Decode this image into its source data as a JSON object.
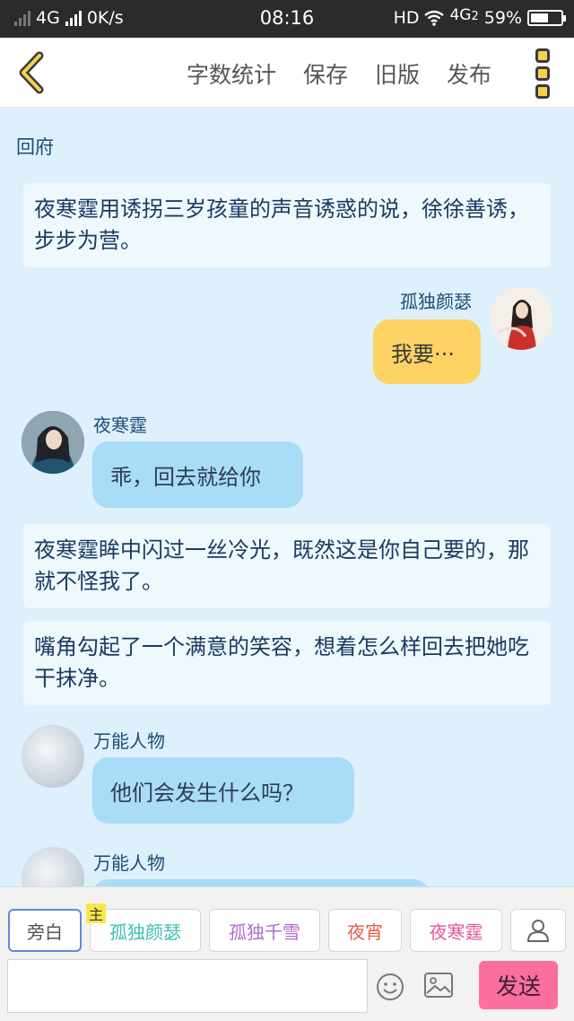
{
  "status_bar": {
    "network": "4G",
    "speed": "0K/s",
    "time": "08:16",
    "hd": "HD",
    "network_right": "4G",
    "network_right_sub": "2",
    "battery": "59%",
    "battery_level": 0.59
  },
  "header": {
    "back_icon": "chevron-left-icon",
    "nav": [
      "字数统计",
      "保存",
      "旧版",
      "发布"
    ],
    "more_icon": "more-vertical-icon"
  },
  "chat": {
    "chapter": "回府",
    "narration_1": "夜寒霆用诱拐三岁孩童的声音诱惑的说，徐徐善诱，步步为营。",
    "msg_1": {
      "name": "孤独颜瑟",
      "text": "我要···"
    },
    "msg_2": {
      "name": "夜寒霆",
      "text": "乖，回去就给你"
    },
    "narration_2": "夜寒霆眸中闪过一丝冷光，既然这是你自己要的，那就不怪我了。",
    "narration_3": "嘴角勾起了一个满意的笑容，想着怎么样回去把她吃干抹净。",
    "msg_3": {
      "name": "万能人物",
      "text": "他们会发生什么吗？"
    },
    "msg_4": {
      "name": "万能人物",
      "text": ""
    }
  },
  "bottom": {
    "roles": [
      {
        "label": "旁白",
        "color": "#555555"
      },
      {
        "label": "孤独颜瑟",
        "color": "#3dbfb0"
      },
      {
        "label": "孤独千雪",
        "color": "#b36ad1"
      },
      {
        "label": "夜宵",
        "color": "#e06048"
      },
      {
        "label": "夜寒霆",
        "color": "#e2579a"
      }
    ],
    "host_tag": "主",
    "add_role_icon": "person-icon",
    "input_value": "",
    "input_placeholder": "",
    "emoji_icon": "smiley-icon",
    "image_icon": "image-icon",
    "send_label": "发送",
    "send_color": "#fb6fa0"
  }
}
